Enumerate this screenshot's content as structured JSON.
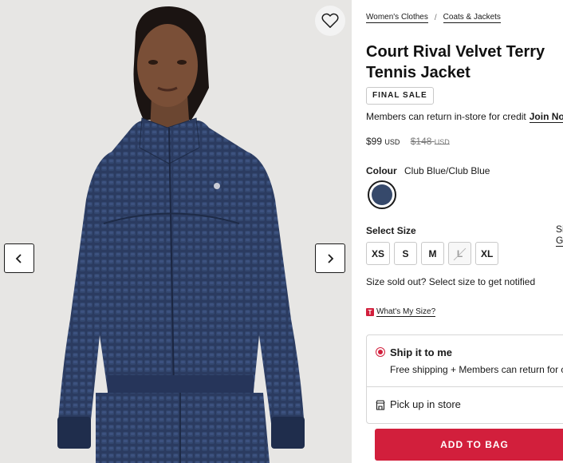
{
  "breadcrumb": {
    "items": [
      "Women's Clothes",
      "Coats & Jackets"
    ],
    "separator": "/"
  },
  "product": {
    "title": "Court Rival Velvet Terry Tennis Jacket",
    "badge": "FINAL SALE",
    "members_note": "Members can return in-store for credit",
    "join_link": "Join Now",
    "price": "$99",
    "price_currency": "USD",
    "original_price": "$148",
    "original_currency": "USD",
    "colour_label": "Colour",
    "colour_value": "Club Blue/Club Blue",
    "swatch_color": "#36496b"
  },
  "sizes": {
    "label": "Select Size",
    "guide_link": "Size Guide",
    "options": [
      {
        "label": "XS",
        "available": true
      },
      {
        "label": "S",
        "available": true
      },
      {
        "label": "M",
        "available": true
      },
      {
        "label": "L",
        "available": false
      },
      {
        "label": "XL",
        "available": true
      }
    ],
    "sold_out_note": "Size sold out? Select size to get notified",
    "whats_my_size": "What's My Size?",
    "whats_my_size_icon": "T"
  },
  "delivery": {
    "ship_title": "Ship it to me",
    "ship_subtitle": "Free shipping + Members can return for credit",
    "pickup_title": "Pick up in store"
  },
  "cta": {
    "add_to_bag": "ADD TO BAG"
  },
  "icons": {
    "favorite": "heart-icon",
    "prev": "chevron-left-icon",
    "next": "chevron-right-icon",
    "store": "store-icon"
  },
  "colors": {
    "accent": "#d21f3c",
    "jacket": "#2a3a5e",
    "background": "#e7e6e4"
  }
}
